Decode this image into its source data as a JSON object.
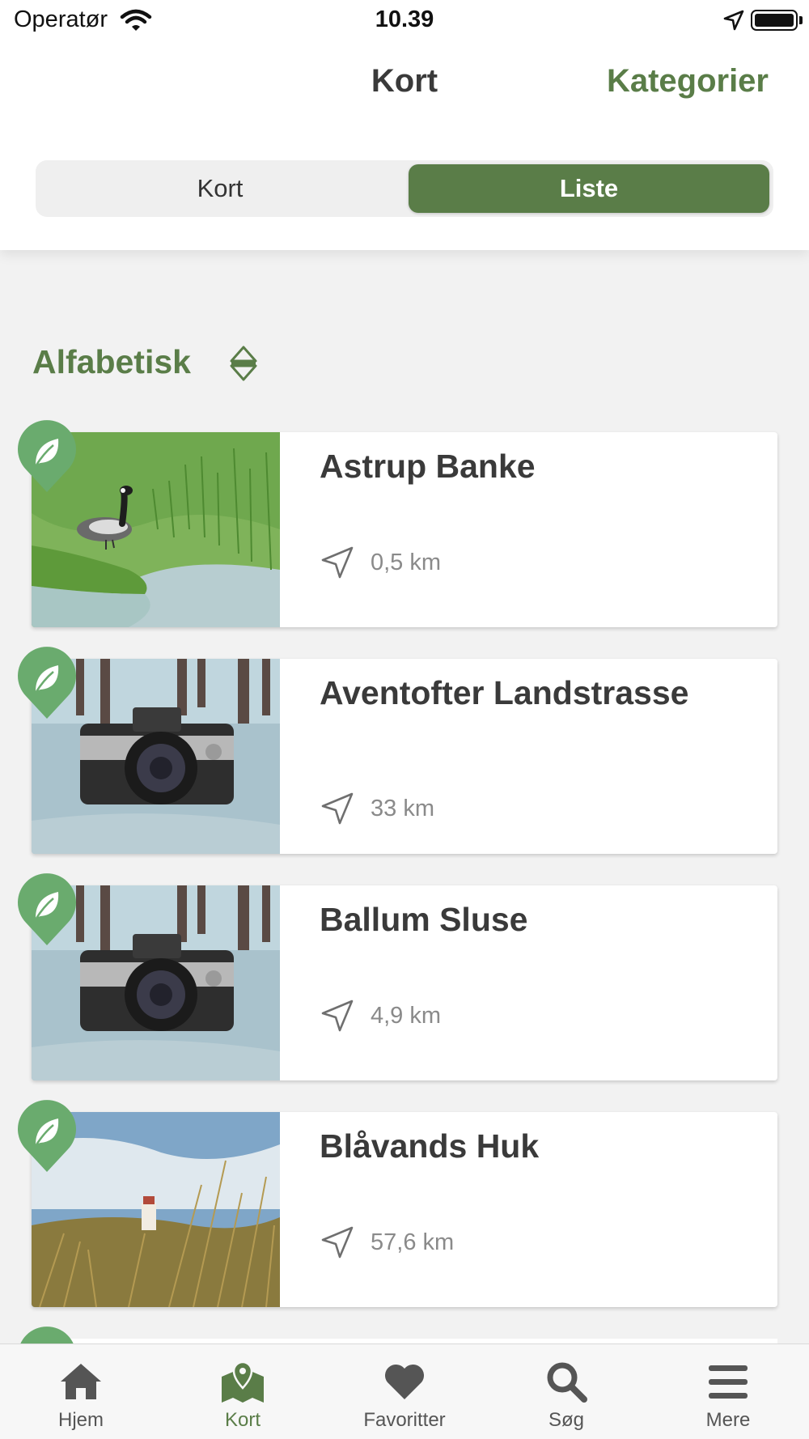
{
  "status_bar": {
    "carrier": "Operatør",
    "time": "10.39"
  },
  "nav": {
    "title": "Kort",
    "action": "Kategorier"
  },
  "segmented": {
    "left": "Kort",
    "right": "Liste",
    "selected": "Liste"
  },
  "sort": {
    "label": "Alfabetisk"
  },
  "items": [
    {
      "title": "Astrup Banke",
      "distance": "0,5 km",
      "image": "goose-wetland"
    },
    {
      "title": "Aventofter Landstrasse",
      "distance": "33 km",
      "image": "camera-beach"
    },
    {
      "title": "Ballum Sluse",
      "distance": "4,9 km",
      "image": "camera-beach"
    },
    {
      "title": "Blåvands Huk",
      "distance": "57,6 km",
      "image": "lighthouse-dunes"
    }
  ],
  "tabs": [
    {
      "label": "Hjem",
      "icon": "home-icon"
    },
    {
      "label": "Kort",
      "icon": "map-icon",
      "active": true
    },
    {
      "label": "Favoritter",
      "icon": "heart-icon"
    },
    {
      "label": "Søg",
      "icon": "search-icon"
    },
    {
      "label": "Mere",
      "icon": "menu-icon"
    }
  ],
  "colors": {
    "accent": "#5a7d48",
    "pin": "#6aab6e",
    "background": "#f2f2f2"
  }
}
